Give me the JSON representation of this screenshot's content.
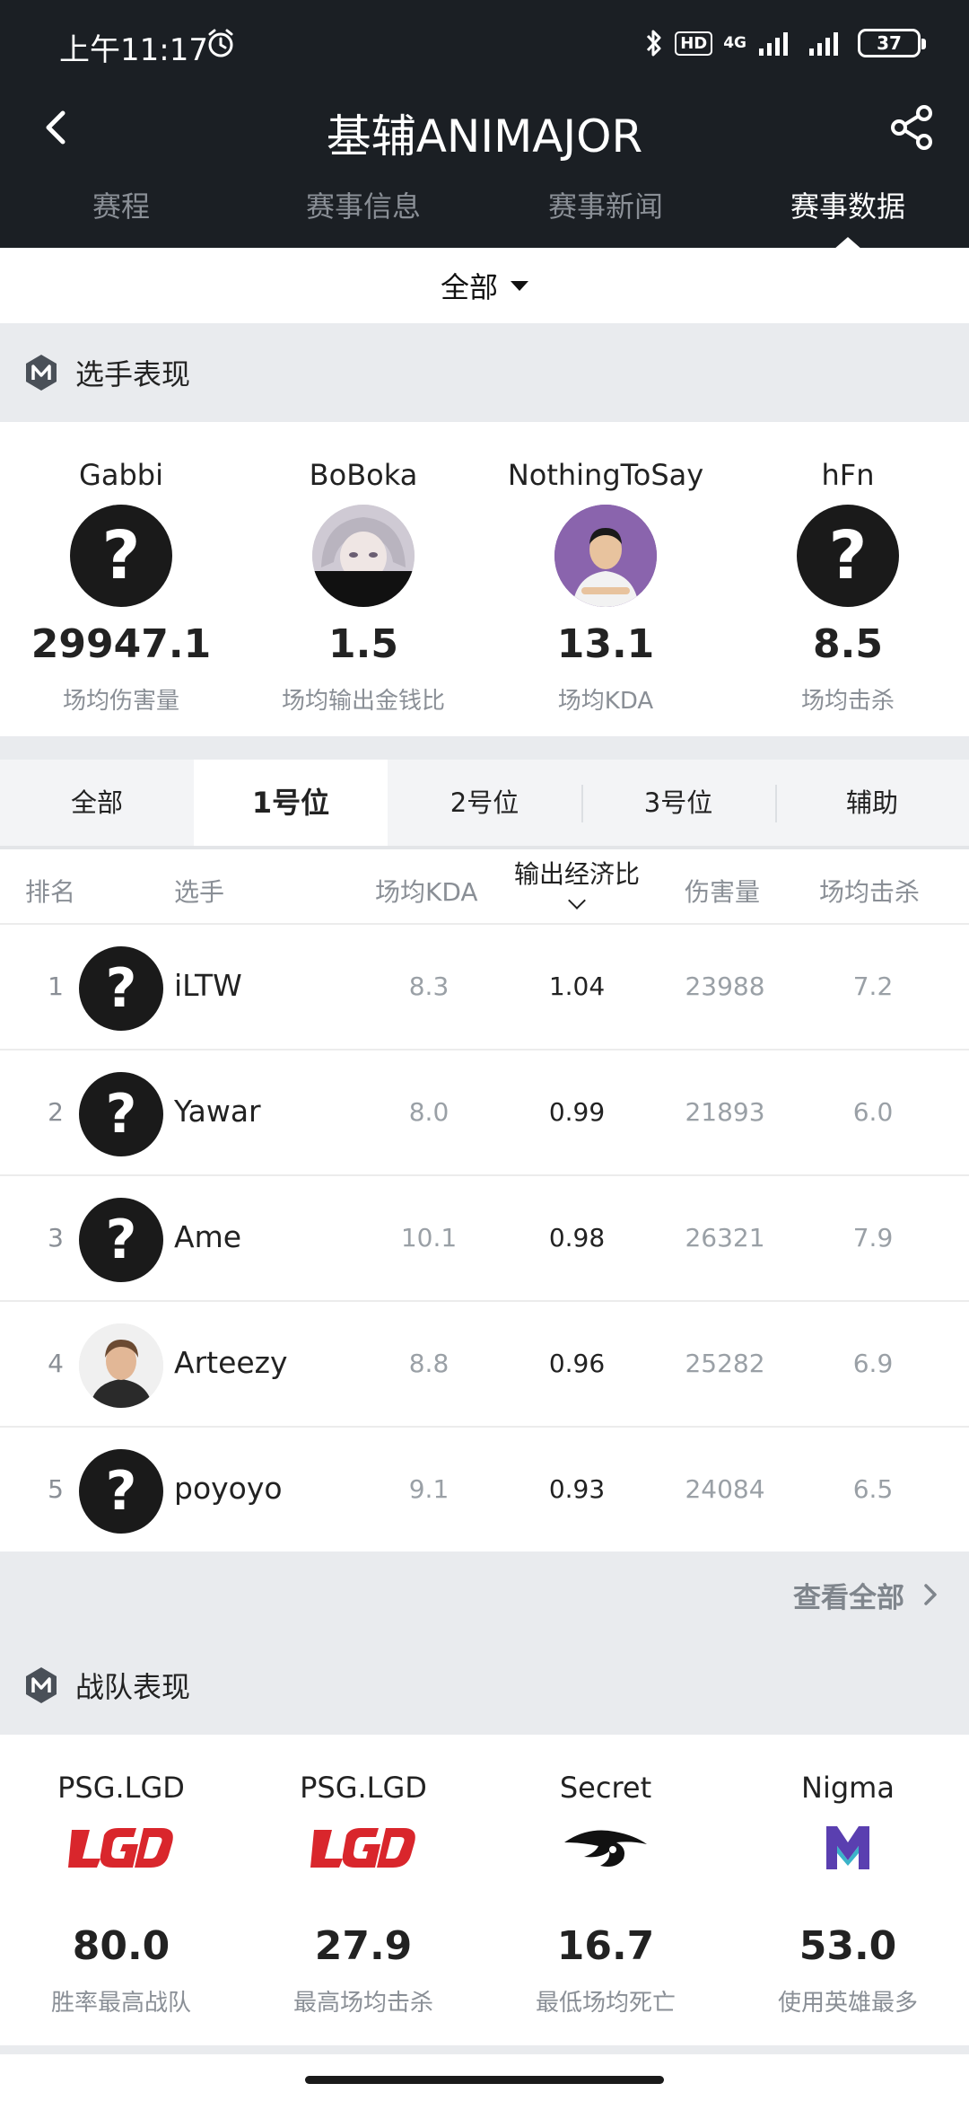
{
  "status_bar": {
    "time": "上午11:17",
    "hd": "HD",
    "network": "4G",
    "battery": "37"
  },
  "header": {
    "title": "基辅ANIMAJOR",
    "tabs": [
      {
        "label": "赛程",
        "active": false
      },
      {
        "label": "赛事信息",
        "active": false
      },
      {
        "label": "赛事新闻",
        "active": false
      },
      {
        "label": "赛事数据",
        "active": true
      }
    ]
  },
  "filter": {
    "label": "全部"
  },
  "player_section": {
    "title": "选手表现",
    "cards": [
      {
        "name": "Gabbi",
        "value": "29947.1",
        "desc": "场均伤害量",
        "avatar": "question-mark"
      },
      {
        "name": "BoBoka",
        "value": "1.5",
        "desc": "场均输出金钱比",
        "avatar": "anime-portrait"
      },
      {
        "name": "NothingToSay",
        "value": "13.1",
        "desc": "场均KDA",
        "avatar": "player-photo"
      },
      {
        "name": "hFn",
        "value": "8.5",
        "desc": "场均击杀",
        "avatar": "question-mark"
      }
    ]
  },
  "position_tabs": [
    {
      "label": "全部",
      "active": false
    },
    {
      "label": "1号位",
      "active": true
    },
    {
      "label": "2号位",
      "active": false
    },
    {
      "label": "3号位",
      "active": false
    },
    {
      "label": "辅助",
      "active": false
    }
  ],
  "table": {
    "headers": {
      "rank": "排名",
      "player": "选手",
      "kda": "场均KDA",
      "econ": "输出经济比",
      "damage": "伤害量",
      "kills": "场均击杀"
    },
    "rows": [
      {
        "rank": "1",
        "name": "iLTW",
        "kda": "8.3",
        "econ": "1.04",
        "damage": "23988",
        "kills": "7.2",
        "avatar": "question-mark"
      },
      {
        "rank": "2",
        "name": "Yawar",
        "kda": "8.0",
        "econ": "0.99",
        "damage": "21893",
        "kills": "6.0",
        "avatar": "question-mark"
      },
      {
        "rank": "3",
        "name": "Ame",
        "kda": "10.1",
        "econ": "0.98",
        "damage": "26321",
        "kills": "7.9",
        "avatar": "question-mark"
      },
      {
        "rank": "4",
        "name": "Arteezy",
        "kda": "8.8",
        "econ": "0.96",
        "damage": "25282",
        "kills": "6.9",
        "avatar": "player-photo"
      },
      {
        "rank": "5",
        "name": "poyoyo",
        "kda": "9.1",
        "econ": "0.93",
        "damage": "24084",
        "kills": "6.5",
        "avatar": "question-mark"
      }
    ],
    "view_all": "查看全部"
  },
  "team_section": {
    "title": "战队表现",
    "cards": [
      {
        "name": "PSG.LGD",
        "value": "80.0",
        "desc": "胜率最高战队",
        "logo": "lgd-logo"
      },
      {
        "name": "PSG.LGD",
        "value": "27.9",
        "desc": "最高场均击杀",
        "logo": "lgd-logo"
      },
      {
        "name": "Secret",
        "value": "16.7",
        "desc": "最低场均死亡",
        "logo": "secret-logo"
      },
      {
        "name": "Nigma",
        "value": "53.0",
        "desc": "使用英雄最多",
        "logo": "nigma-logo"
      }
    ]
  },
  "colors": {
    "header_bg": "#1b1f24",
    "section_bg": "#e9ebee",
    "lgd_red": "#d9262c",
    "nigma_purple": "#5a3fb0"
  }
}
